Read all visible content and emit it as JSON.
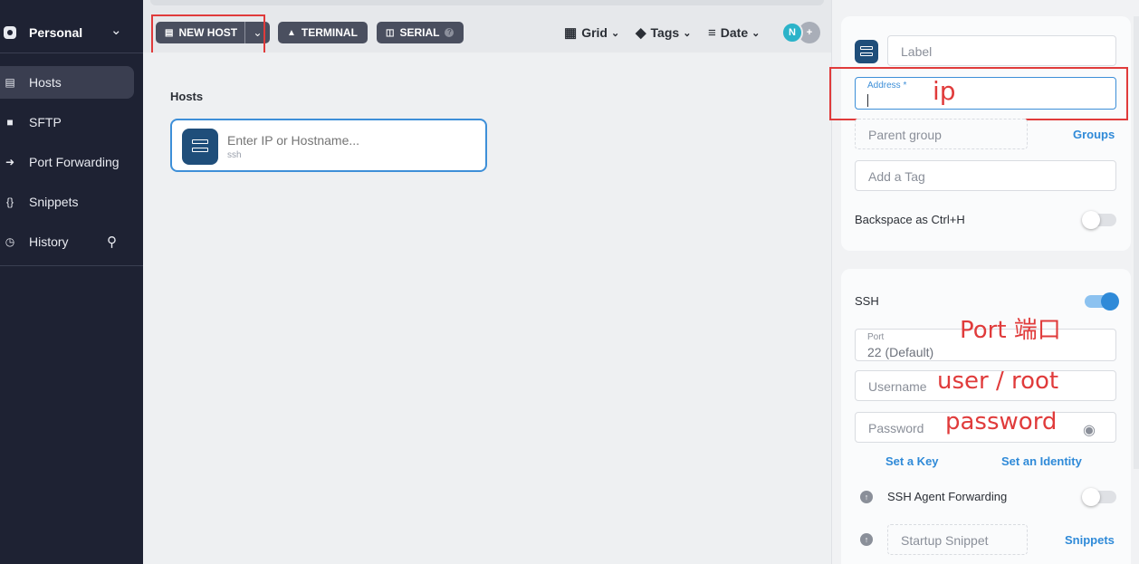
{
  "sidebar": {
    "account": {
      "name": "Personal"
    },
    "items": [
      {
        "label": "Hosts",
        "icon": "server-icon",
        "active": true
      },
      {
        "label": "SFTP",
        "icon": "folder-icon",
        "active": false
      },
      {
        "label": "Port Forwarding",
        "icon": "forward-icon",
        "active": false
      },
      {
        "label": "Snippets",
        "icon": "braces-icon",
        "active": false
      },
      {
        "label": "History",
        "icon": "clock-icon",
        "active": false
      }
    ]
  },
  "toolbar": {
    "new_host": "NEW HOST",
    "terminal": "TERMINAL",
    "serial": "SERIAL",
    "view_grid": "Grid",
    "view_tags": "Tags",
    "view_date": "Date",
    "avatar_initial": "N",
    "avatar_add": "+"
  },
  "main": {
    "section_title": "Hosts",
    "host_placeholder": "Enter IP or Hostname...",
    "host_protocol": "ssh"
  },
  "panel": {
    "label_placeholder": "Label",
    "address_label": "Address *",
    "parent_group_placeholder": "Parent group",
    "groups_link": "Groups",
    "tag_placeholder": "Add a Tag",
    "backspace_label": "Backspace as Ctrl+H",
    "backspace_on": false,
    "ssh_label": "SSH",
    "ssh_on": true,
    "port_label": "Port",
    "port_value": "22 (Default)",
    "username_placeholder": "Username",
    "password_placeholder": "Password",
    "set_key": "Set a Key",
    "set_identity": "Set an Identity",
    "agent_forwarding": "SSH Agent Forwarding",
    "agent_forwarding_on": false,
    "startup_snippet_placeholder": "Startup Snippet",
    "snippets_link": "Snippets"
  },
  "annotations": {
    "ip": "ip",
    "port": "Port 端口",
    "user": "user / root",
    "password": "password"
  },
  "colors": {
    "sidebar_bg": "#1e2233",
    "accent": "#2f8ad8",
    "annotation_red": "#e03b3b",
    "host_icon_bg": "#1f4e7a"
  }
}
